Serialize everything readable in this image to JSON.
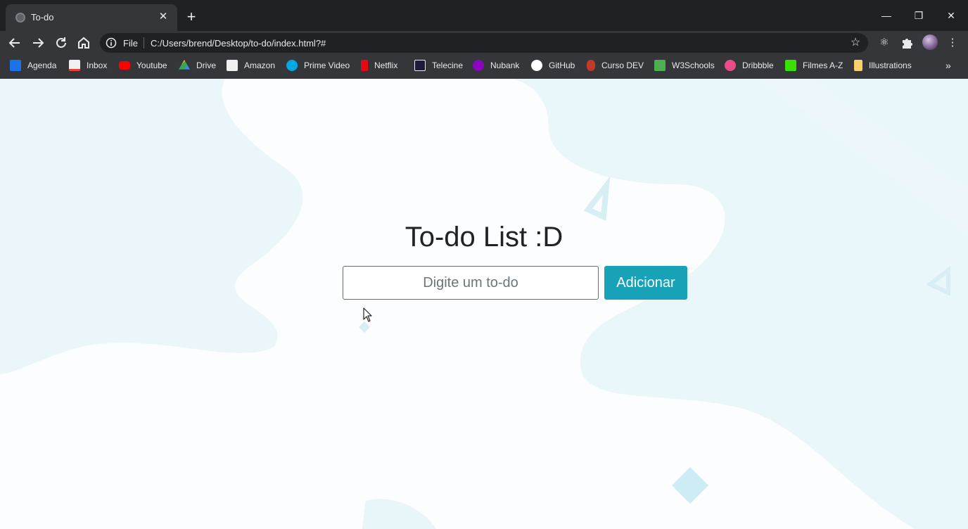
{
  "browser": {
    "tab_title": "To-do",
    "omnibox": {
      "scheme_label": "File",
      "url": "C:/Users/brend/Desktop/to-do/index.html?#"
    },
    "bookmarks": [
      {
        "label": "Agenda",
        "icon": "calendar-icon",
        "color": "#1a73e8"
      },
      {
        "label": "Inbox",
        "icon": "gmail-icon",
        "color": "#ea4335"
      },
      {
        "label": "Youtube",
        "icon": "youtube-icon",
        "color": "#ff0000"
      },
      {
        "label": "Drive",
        "icon": "drive-icon",
        "color": "#34a853"
      },
      {
        "label": "Amazon",
        "icon": "amazon-icon",
        "color": "#f1f1f1"
      },
      {
        "label": "Prime Video",
        "icon": "prime-video-icon",
        "color": "#00a8e1"
      },
      {
        "label": "Netflix",
        "icon": "netflix-icon",
        "color": "#e50914"
      },
      {
        "label": "Telecine",
        "icon": "telecine-icon",
        "color": "#1b1b3a"
      },
      {
        "label": "Nubank",
        "icon": "nubank-icon",
        "color": "#8a05be"
      },
      {
        "label": "GitHub",
        "icon": "github-icon",
        "color": "#ffffff"
      },
      {
        "label": "Curso DEV",
        "icon": "curso-dev-icon",
        "color": "#c0392b"
      },
      {
        "label": "W3Schools",
        "icon": "w3schools-icon",
        "color": "#4caf50"
      },
      {
        "label": "Dribbble",
        "icon": "dribbble-icon",
        "color": "#ea4c89"
      },
      {
        "label": "Filmes A-Z",
        "icon": "filmes-icon",
        "color": "#3ce000"
      },
      {
        "label": "Illustrations",
        "icon": "folder-icon",
        "color": "#f6d26b"
      }
    ]
  },
  "page": {
    "title": "To-do List :D",
    "input_placeholder": "Digite um to-do",
    "input_value": "",
    "add_button_label": "Adicionar"
  },
  "colors": {
    "accent": "#17a2b8",
    "blob": "#e3f4f8"
  }
}
